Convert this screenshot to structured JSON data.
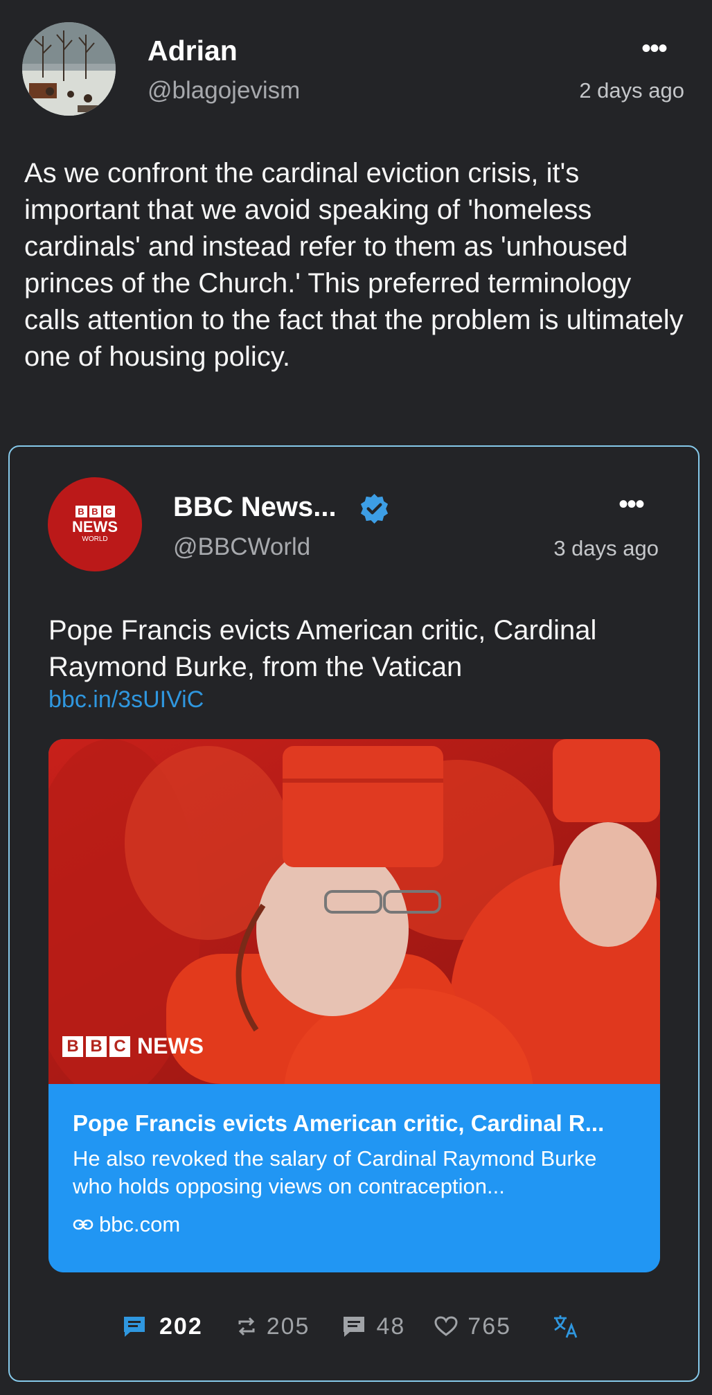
{
  "post": {
    "author_name": "Adrian",
    "author_handle": "@blagojevism",
    "time": "2 days ago",
    "more_label": "•••",
    "text": "As we confront the cardinal eviction crisis, it's important that we avoid speaking of 'homeless cardinals' and instead refer to them as 'unhoused princes of the Church.' This preferred terminology calls attention to the fact that the problem is ultimately one of housing policy."
  },
  "quote": {
    "author_name": "BBC News...",
    "author_handle": "@BBCWorld",
    "time": "3 days ago",
    "more_label": "•••",
    "avatar": {
      "letters": [
        "B",
        "B",
        "C"
      ],
      "news": "NEWS",
      "world": "WORLD"
    },
    "text": "Pope Francis evicts American critic, Cardinal Raymond Burke, from the Vatican",
    "link": "bbc.in/3sUIViC",
    "preview": {
      "image_logo_letters": [
        "B",
        "B",
        "C"
      ],
      "image_logo_news": "NEWS",
      "title": "Pope Francis evicts American critic, Cardinal R...",
      "description": "He also revoked the salary of Cardinal Raymond Burke who holds opposing views on contraception...",
      "domain": "bbc.com"
    }
  },
  "actions": {
    "replies": "202",
    "boosts": "205",
    "comments": "48",
    "likes": "765"
  },
  "colors": {
    "background": "#232427",
    "accent_link": "#2f97df",
    "preview_card": "#2196f3",
    "quote_border": "#86c9ea",
    "bbc_red": "#bb1919"
  }
}
